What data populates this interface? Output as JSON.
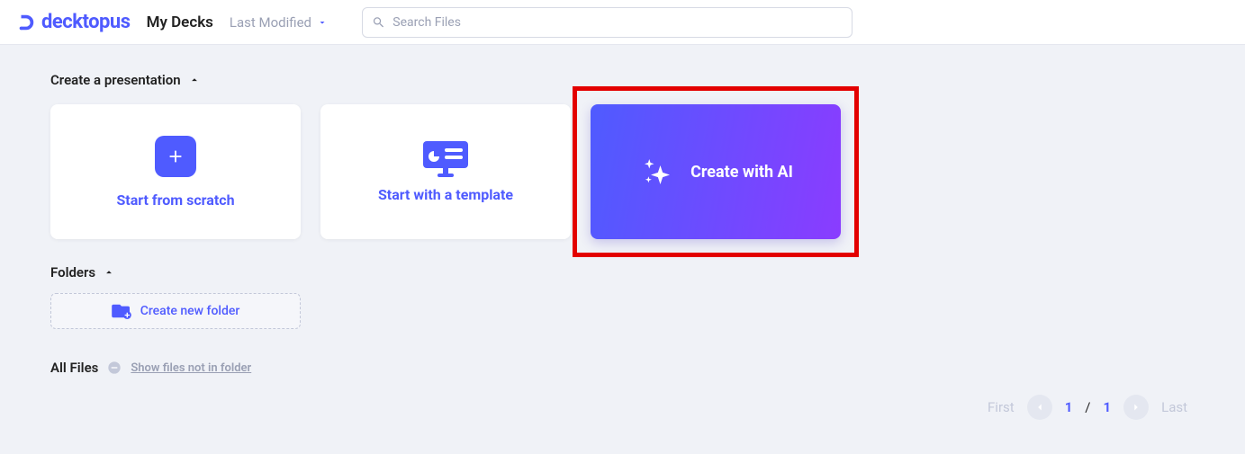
{
  "brand": "decktopus",
  "header": {
    "page_title": "My Decks",
    "sort_label": "Last Modified",
    "search_placeholder": "Search Files"
  },
  "create": {
    "section_title": "Create a presentation",
    "scratch_label": "Start from scratch",
    "template_label": "Start with a template",
    "ai_label": "Create with AI"
  },
  "folders": {
    "section_title": "Folders",
    "new_folder_label": "Create new folder"
  },
  "files": {
    "all_label": "All Files",
    "show_link": "Show files not in folder"
  },
  "pager": {
    "first": "First",
    "current": "1",
    "total": "1",
    "last": "Last"
  },
  "colors": {
    "primary": "#4f5bff"
  }
}
